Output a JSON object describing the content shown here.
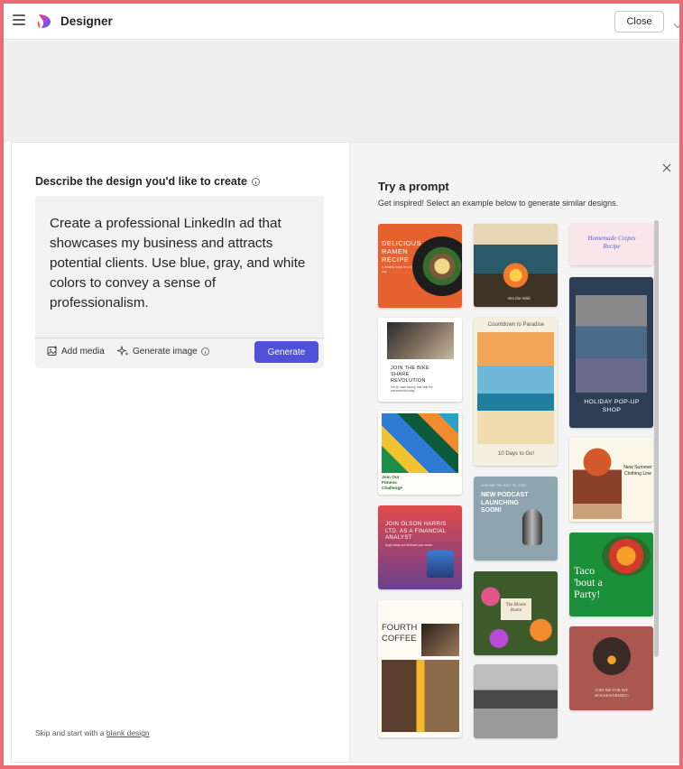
{
  "app": {
    "title": "Designer",
    "close_label": "Close"
  },
  "left": {
    "describe_label": "Describe the design you'd like to create",
    "prompt_text": "Create a professional LinkedIn ad that showcases my business and attracts potential clients. Use blue, gray, and white colors to convey a sense of professionalism.",
    "add_media_label": "Add media",
    "generate_image_label": "Generate image",
    "generate_label": "Generate",
    "skip_text": "Skip and start with a",
    "skip_link": "blank design"
  },
  "right": {
    "title": "Try a prompt",
    "subtitle": "Get inspired! Select an example below to generate similar designs.",
    "cards": {
      "ramen": {
        "title": "DELICIOUS RAMEN RECIPE",
        "sub": "a healthy meal for a busy day"
      },
      "bonfire": {
        "caption": "Into the Wild"
      },
      "crepes": {
        "title": "Homemade Crepes Recipe"
      },
      "bike": {
        "title": "JOIN THE BIKE SHARE REVOLUTION",
        "sub": "Get fit, save money, and help the environment today!"
      },
      "paradise": {
        "header": "Countdown to Paradise",
        "caption": "10 Days to Go!"
      },
      "holiday": {
        "title": "HOLIDAY POP-UP SHOP"
      },
      "fitness": {
        "title": "Join Our Fitness Challenge"
      },
      "podcast": {
        "date": "JOIN ME ON JULY 21, 2023",
        "title": "NEW PODCAST LAUNCHING SOON!"
      },
      "clothing": {
        "title": "New Summer Clothing Line"
      },
      "financial": {
        "title": "JOIN OLSON HARRIS LTD. AS A FINANCIAL ANALYST",
        "sub": "Apply today and kickstart your career"
      },
      "bloom": {
        "title": "The Bloom Room"
      },
      "taco": {
        "title": "Taco 'bout a Party!"
      },
      "coffee": {
        "title": "FOURTH COFFEE"
      },
      "housewarming": {
        "title": "JOIN ME FOR MY HOUSEWARMING"
      }
    }
  },
  "colors": {
    "accent": "#4f52d9",
    "frame_border": "#ec6a73"
  }
}
